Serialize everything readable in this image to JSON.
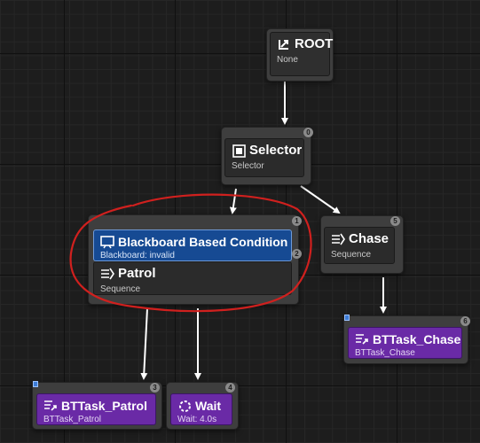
{
  "graph": {
    "nodes": {
      "root": {
        "title": "ROOT",
        "subtitle": "None",
        "icon": "root-icon"
      },
      "selector": {
        "title": "Selector",
        "subtitle": "Selector",
        "icon": "selector-icon",
        "index": "0"
      },
      "patrol": {
        "decorator": {
          "title": "Blackboard Based Condition",
          "subtitle": "Blackboard: invalid",
          "icon": "blackboard-icon",
          "index": "1"
        },
        "title": "Patrol",
        "subtitle": "Sequence",
        "icon": "sequence-icon",
        "index": "2"
      },
      "chase": {
        "title": "Chase",
        "subtitle": "Sequence",
        "icon": "sequence-icon",
        "index": "5"
      },
      "bttask_chase": {
        "title": "BTTask_Chase",
        "subtitle": "BTTask_Chase",
        "icon": "task-icon",
        "index": "6"
      },
      "bttask_patrol": {
        "title": "BTTask_Patrol",
        "subtitle": "BTTask_Patrol",
        "icon": "task-icon",
        "index": "3"
      },
      "wait": {
        "title": "Wait",
        "subtitle": "Wait: 4.0s",
        "icon": "wait-icon",
        "index": "4"
      }
    }
  },
  "colors": {
    "background": "#1d1d1d",
    "node": "#3e3e3e",
    "composite": "#2b2b2b",
    "task": "#6a2aa6",
    "decorator": "#164a93",
    "wire": "#ffffff",
    "annotation": "#d0201e"
  }
}
